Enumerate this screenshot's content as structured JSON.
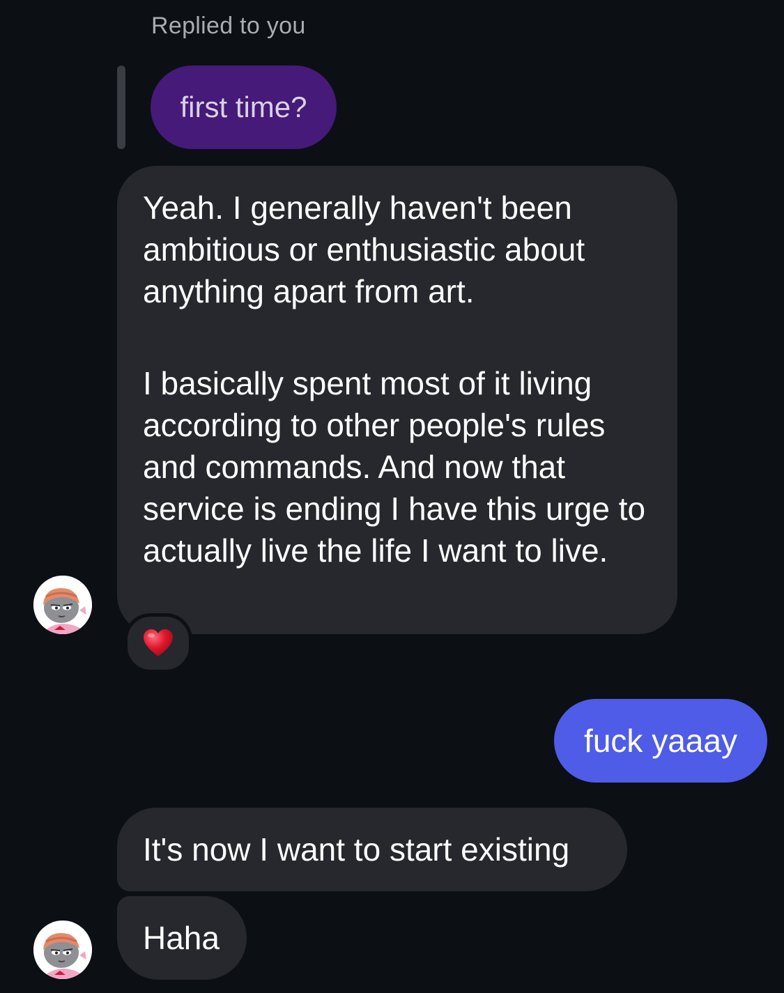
{
  "thread": {
    "reply_header": "Replied to you",
    "quoted_message": "first time?"
  },
  "messages": [
    {
      "sender": "them",
      "paragraphs": [
        "Yeah. I generally haven't been ambitious or enthusiastic about anything apart from art.",
        "I basically spent most of it living according to other people's rules and commands. And now that service is ending I have this urge to actually live the life I want to live."
      ],
      "reaction": "heart"
    },
    {
      "sender": "me",
      "text": "fuck yaaay"
    },
    {
      "sender": "them",
      "text": "It's now I want to start existing"
    },
    {
      "sender": "them",
      "text": "Haha"
    }
  ],
  "colors": {
    "background": "#0c0f14",
    "incoming_bubble": "#26282d",
    "outgoing_bubble": "#4e5ce8",
    "quoted_bubble": "#461a78",
    "reaction_heart": "#e0182d"
  },
  "icons": {
    "reaction": "heart-icon",
    "avatar": "cartoon-avatar"
  }
}
